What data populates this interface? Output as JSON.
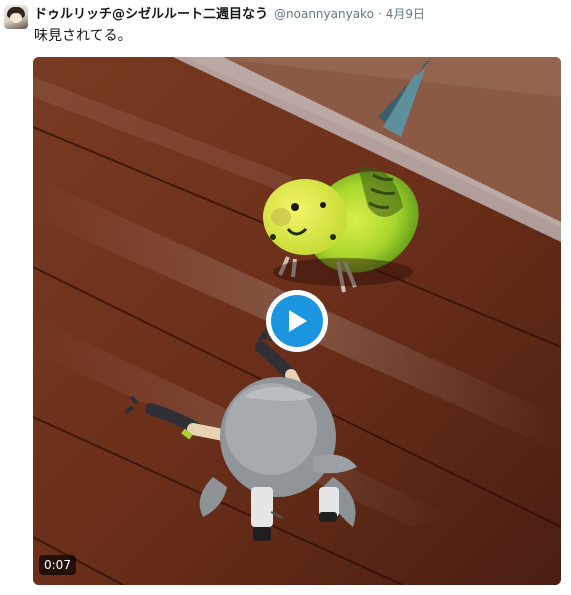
{
  "tweet": {
    "display_name": "ドゥルリッチ@シゼルルート二週目なう",
    "handle": "@noannyanyako",
    "separator": "·",
    "timestamp": "4月9日",
    "text": "味見されてる。"
  },
  "media": {
    "type": "video",
    "duration": "0:07",
    "play_icon": "play-icon",
    "accent_color": "#1b95e0"
  },
  "colors": {
    "name": "#14171a",
    "meta": "#657786",
    "background": "#ffffff"
  }
}
